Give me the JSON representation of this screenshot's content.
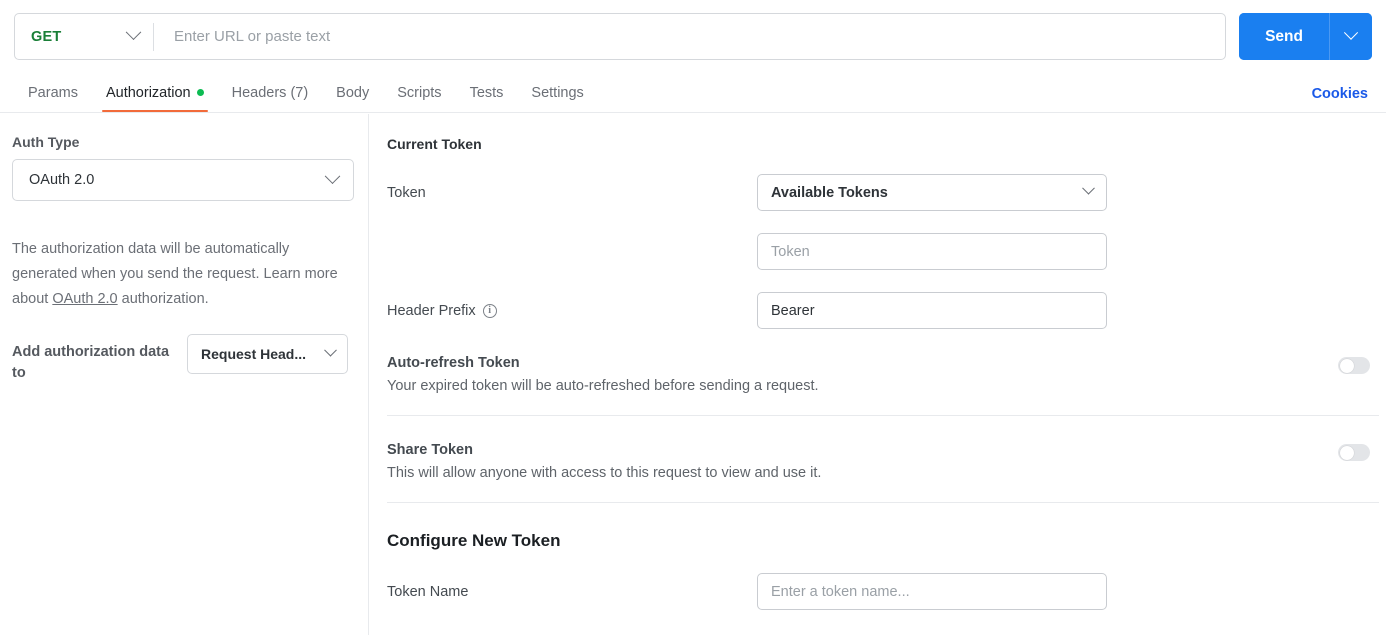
{
  "request_bar": {
    "method": "GET",
    "method_caret_icon": "chevron-down-icon",
    "url_placeholder": "Enter URL or paste text",
    "url_value": "",
    "send_label": "Send",
    "send_caret_icon": "chevron-down-icon"
  },
  "tabs": {
    "items": [
      {
        "label": "Params",
        "active": false,
        "has_dot": false
      },
      {
        "label": "Authorization",
        "active": true,
        "has_dot": true
      },
      {
        "label": "Headers (7)",
        "active": false,
        "has_dot": false
      },
      {
        "label": "Body",
        "active": false,
        "has_dot": false
      },
      {
        "label": "Scripts",
        "active": false,
        "has_dot": false
      },
      {
        "label": "Tests",
        "active": false,
        "has_dot": false
      },
      {
        "label": "Settings",
        "active": false,
        "has_dot": false
      }
    ],
    "cookies_label": "Cookies",
    "active_indicator_color": "#f26b3a",
    "dot_color": "#0cbb52",
    "cookies_color": "#1a59e8"
  },
  "auth_panel": {
    "auth_type_label": "Auth Type",
    "auth_type_value": "OAuth 2.0",
    "help_text_before": "The authorization data will be automatically generated when you send the request. Learn more about ",
    "help_link": "OAuth 2.0",
    "help_text_after": " authorization.",
    "add_auth_label": "Add authorization data to",
    "add_auth_value": "Request Head...",
    "caret_icon": "chevron-down-icon"
  },
  "current_token": {
    "heading": "Current Token",
    "token_label": "Token",
    "token_select_value": "Available Tokens",
    "token_input_placeholder": "Token",
    "token_input_value": "",
    "header_prefix_label": "Header Prefix",
    "header_prefix_info_icon": "info-icon",
    "header_prefix_value": "Bearer",
    "auto_refresh": {
      "title": "Auto-refresh Token",
      "description": "Your expired token will be auto-refreshed before sending a request.",
      "enabled": "off"
    },
    "share_token": {
      "title": "Share Token",
      "description": "This will allow anyone with access to this request to view and use it.",
      "enabled": "off"
    }
  },
  "configure_new_token": {
    "heading": "Configure New Token",
    "token_name_label": "Token Name",
    "token_name_placeholder": "Enter a token name...",
    "token_name_value": ""
  },
  "theme": {
    "accent_blue": "#1a7ff0",
    "method_green": "#1a7f37",
    "tab_orange": "#f26b3a",
    "link_blue": "#1a59e8",
    "dot_green": "#0cbb52"
  }
}
